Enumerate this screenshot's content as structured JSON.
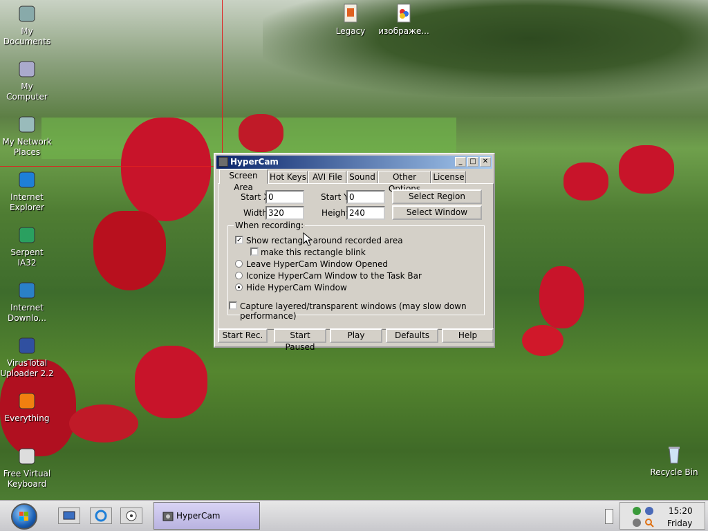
{
  "desktop": {
    "left_icons": [
      {
        "label": "My\nDocuments",
        "icon": "my-documents-icon"
      },
      {
        "label": "My Computer",
        "icon": "my-computer-icon"
      },
      {
        "label": "My Network\nPlaces",
        "icon": "network-places-icon"
      },
      {
        "label": "Internet\nExplorer",
        "icon": "internet-explorer-icon"
      },
      {
        "label": "Serpent IA32",
        "icon": "serpent-icon"
      },
      {
        "label": "Internet\nDownlo...",
        "icon": "internet-download-icon"
      },
      {
        "label": "VirusTotal\nUploader 2.2",
        "icon": "virustotal-icon"
      },
      {
        "label": "Everything",
        "icon": "everything-icon"
      },
      {
        "label": "Free Virtual\nKeyboard",
        "icon": "keyboard-icon"
      }
    ],
    "top_icons": [
      {
        "label": "Legacy",
        "icon": "folder-icon"
      },
      {
        "label": "изображе...",
        "icon": "image-file-icon"
      }
    ],
    "recycle_bin": {
      "label": "Recycle Bin",
      "icon": "recycle-bin-icon"
    }
  },
  "window": {
    "title": "HyperCam",
    "controls": {
      "minimize": "_",
      "maximize": "□",
      "close": "✕"
    },
    "tabs": [
      "Screen Area",
      "Hot Keys",
      "AVI File",
      "Sound",
      "Other Options",
      "License"
    ],
    "active_tab": "Screen Area",
    "fields": {
      "start_x_label": "Start X",
      "start_x_value": "0",
      "start_y_label": "Start Y",
      "start_y_value": "0",
      "width_label": "Width",
      "width_value": "320",
      "height_label": "Height",
      "height_value": "240"
    },
    "select_region": "Select Region",
    "select_window": "Select Window",
    "group_title": "When recording:",
    "options": {
      "show_rect": "Show rectangle around recorded area",
      "blink": "make this rectangle blink",
      "leave_open": "Leave HyperCam Window Opened",
      "iconize": "Iconize HyperCam Window to the Task Bar",
      "hide": "Hide HyperCam Window"
    },
    "capture_layered": "Capture layered/transparent windows (may slow down performance)",
    "buttons": [
      "Start Rec.",
      "Start Paused",
      "Play",
      "Defaults",
      "Help"
    ]
  },
  "taskbar": {
    "task_label": "HyperCam",
    "clock_time": "15:20",
    "clock_day": "Friday"
  }
}
